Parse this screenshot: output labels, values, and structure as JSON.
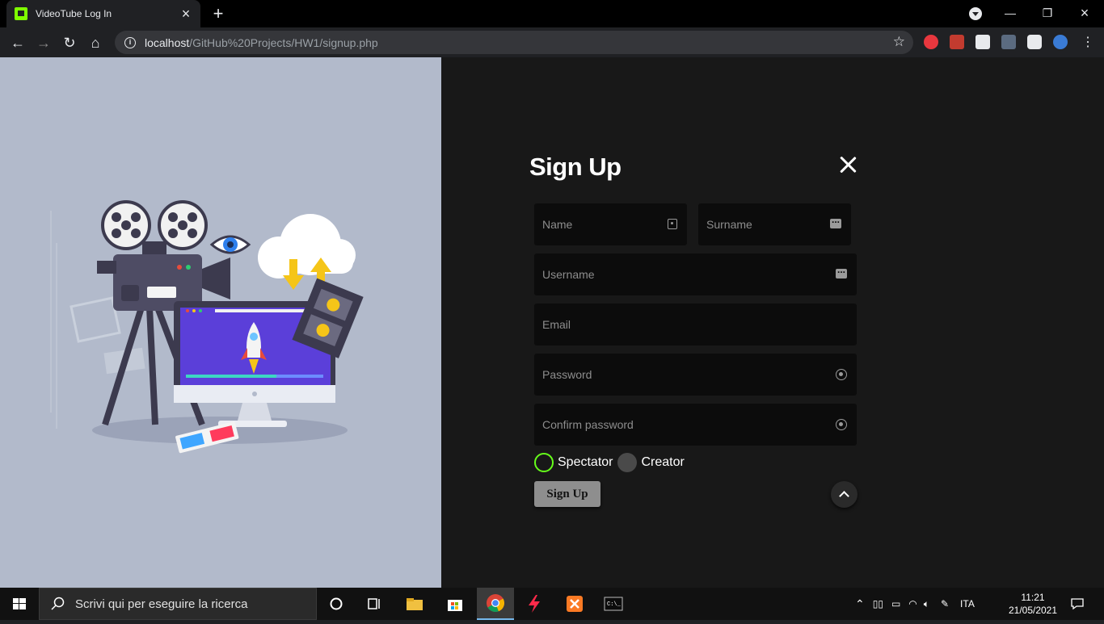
{
  "browser": {
    "tab_title": "VideoTube Log In",
    "url_host": "localhost",
    "url_path": "/GitHub%20Projects/HW1/signup.php"
  },
  "extensions": [
    "abp-icon",
    "wallet-icon",
    "calculator-icon",
    "dots-icon",
    "puzzle-icon",
    "profile-avatar"
  ],
  "form": {
    "title": "Sign Up",
    "fields": {
      "name_placeholder": "Name",
      "surname_placeholder": "Surname",
      "username_placeholder": "Username",
      "email_placeholder": "Email",
      "password_placeholder": "Password",
      "confirm_placeholder": "Confirm password"
    },
    "roles": [
      {
        "label": "Spectator",
        "checked": true
      },
      {
        "label": "Creator",
        "checked": false
      }
    ],
    "submit_label": "Sign Up"
  },
  "colors": {
    "accent_green": "#66ff1a",
    "panel_bg": "#b2bacb",
    "page_bg": "#181818"
  },
  "taskbar": {
    "search_placeholder": "Scrivi qui per eseguire la ricerca",
    "language": "ITA",
    "time": "11:21",
    "date": "21/05/2021"
  }
}
